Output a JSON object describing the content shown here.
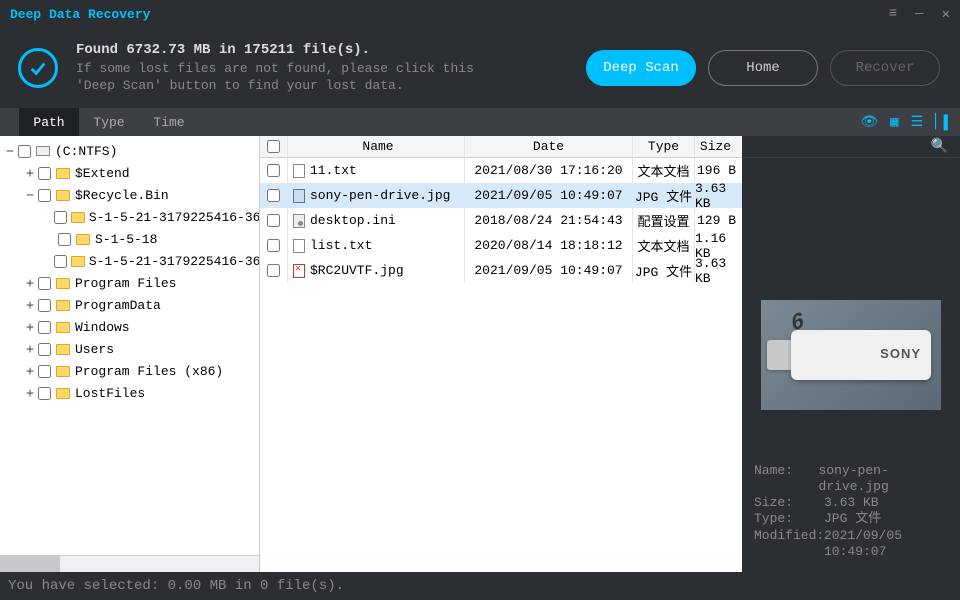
{
  "app": {
    "title": "Deep Data Recovery"
  },
  "header": {
    "found": "Found 6732.73 MB in 175211 file(s).",
    "hint_l1": "If some lost files are not found, please click this",
    "hint_l2": "'Deep Scan' button to find your lost data.",
    "buttons": {
      "deep_scan": "Deep Scan",
      "home": "Home",
      "recover": "Recover"
    }
  },
  "tabs": {
    "path": "Path",
    "type": "Type",
    "time": "Time"
  },
  "tree": {
    "root": "(C:NTFS)",
    "items": [
      {
        "label": "$Extend",
        "depth": 1,
        "exp": "+"
      },
      {
        "label": "$Recycle.Bin",
        "depth": 1,
        "exp": "−"
      },
      {
        "label": "S-1-5-21-3179225416-36",
        "depth": 2,
        "exp": ""
      },
      {
        "label": "S-1-5-18",
        "depth": 2,
        "exp": ""
      },
      {
        "label": "S-1-5-21-3179225416-36",
        "depth": 2,
        "exp": ""
      },
      {
        "label": "Program Files",
        "depth": 1,
        "exp": "+"
      },
      {
        "label": "ProgramData",
        "depth": 1,
        "exp": "+"
      },
      {
        "label": "Windows",
        "depth": 1,
        "exp": "+"
      },
      {
        "label": "Users",
        "depth": 1,
        "exp": "+"
      },
      {
        "label": "Program Files (x86)",
        "depth": 1,
        "exp": "+"
      },
      {
        "label": "LostFiles",
        "depth": 1,
        "exp": "+"
      }
    ]
  },
  "table": {
    "cols": {
      "name": "Name",
      "date": "Date",
      "type": "Type",
      "size": "Size"
    },
    "rows": [
      {
        "name": "11.txt",
        "date": "2021/08/30 17:16:20",
        "type": "文本文档",
        "size": "196  B",
        "icon": "txt",
        "selected": false
      },
      {
        "name": "sony-pen-drive.jpg",
        "date": "2021/09/05 10:49:07",
        "type": "JPG 文件",
        "size": "3.63 KB",
        "icon": "jpg",
        "selected": true
      },
      {
        "name": "desktop.ini",
        "date": "2018/08/24 21:54:43",
        "type": "配置设置",
        "size": "129  B",
        "icon": "ini",
        "selected": false
      },
      {
        "name": "list.txt",
        "date": "2020/08/14 18:18:12",
        "type": "文本文档",
        "size": "1.16 KB",
        "icon": "txt",
        "selected": false
      },
      {
        "name": "$RC2UVTF.jpg",
        "date": "2021/09/05 10:49:07",
        "type": "JPG 文件",
        "size": "3.63 KB",
        "icon": "broken",
        "selected": false
      }
    ]
  },
  "details": {
    "labels": {
      "name": "Name:",
      "size": "Size:",
      "type": "Type:",
      "modified": "Modified:"
    },
    "values": {
      "name": "sony-pen-drive.jpg",
      "size": "3.63 KB",
      "type": "JPG 文件",
      "modified": "2021/09/05 10:49:07"
    }
  },
  "status": "You have selected: 0.00 MB in 0 file(s).",
  "preview_badge": "6"
}
